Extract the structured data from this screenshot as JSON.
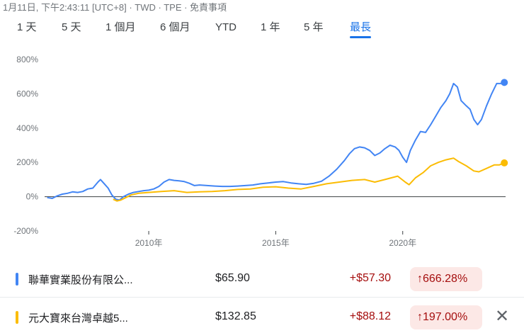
{
  "header": {
    "meta": "1月11日, 下午2:43:11 [UTC+8] · TWD · TPE · 免責事項"
  },
  "tabs": [
    {
      "label": "1 天",
      "active": false
    },
    {
      "label": "5 天",
      "active": false
    },
    {
      "label": "1 個月",
      "active": false
    },
    {
      "label": "6 個月",
      "active": false
    },
    {
      "label": "YTD",
      "active": false
    },
    {
      "label": "1 年",
      "active": false
    },
    {
      "label": "5 年",
      "active": false
    },
    {
      "label": "最長",
      "active": true
    }
  ],
  "chart_data": {
    "type": "line",
    "title": "",
    "xlabel": "",
    "ylabel": "",
    "x_range": [
      2005.9,
      2024.05
    ],
    "ylim": [
      -200,
      800
    ],
    "yticks": [
      800,
      600,
      400,
      200,
      0,
      -200
    ],
    "ytick_labels": [
      "800%",
      "600%",
      "400%",
      "200%",
      "0%",
      "-200%"
    ],
    "xticks": [
      2010,
      2015,
      2020
    ],
    "xtick_labels": [
      "2010年",
      "2015年",
      "2020年"
    ],
    "grid": false,
    "zero_line": true,
    "series": [
      {
        "name": "聯華實業股份有限公...",
        "color": "#4285f4",
        "points": [
          [
            2006.0,
            -5
          ],
          [
            2006.2,
            -10
          ],
          [
            2006.4,
            5
          ],
          [
            2006.6,
            15
          ],
          [
            2006.8,
            20
          ],
          [
            2007.0,
            28
          ],
          [
            2007.2,
            25
          ],
          [
            2007.4,
            30
          ],
          [
            2007.6,
            45
          ],
          [
            2007.8,
            50
          ],
          [
            2008.0,
            85
          ],
          [
            2008.1,
            100
          ],
          [
            2008.25,
            75
          ],
          [
            2008.4,
            50
          ],
          [
            2008.55,
            10
          ],
          [
            2008.7,
            -15
          ],
          [
            2008.85,
            -20
          ],
          [
            2009.0,
            0
          ],
          [
            2009.2,
            15
          ],
          [
            2009.4,
            25
          ],
          [
            2009.6,
            30
          ],
          [
            2009.8,
            35
          ],
          [
            2010.0,
            38
          ],
          [
            2010.2,
            45
          ],
          [
            2010.4,
            60
          ],
          [
            2010.6,
            85
          ],
          [
            2010.8,
            100
          ],
          [
            2011.0,
            95
          ],
          [
            2011.2,
            92
          ],
          [
            2011.4,
            88
          ],
          [
            2011.6,
            78
          ],
          [
            2011.8,
            65
          ],
          [
            2012.0,
            68
          ],
          [
            2012.3,
            65
          ],
          [
            2012.6,
            62
          ],
          [
            2012.9,
            60
          ],
          [
            2013.2,
            60
          ],
          [
            2013.5,
            62
          ],
          [
            2013.8,
            65
          ],
          [
            2014.1,
            68
          ],
          [
            2014.4,
            75
          ],
          [
            2014.7,
            80
          ],
          [
            2015.0,
            85
          ],
          [
            2015.3,
            88
          ],
          [
            2015.6,
            80
          ],
          [
            2015.9,
            75
          ],
          [
            2016.2,
            72
          ],
          [
            2016.5,
            78
          ],
          [
            2016.8,
            90
          ],
          [
            2017.1,
            120
          ],
          [
            2017.4,
            160
          ],
          [
            2017.7,
            210
          ],
          [
            2017.9,
            250
          ],
          [
            2018.1,
            280
          ],
          [
            2018.3,
            290
          ],
          [
            2018.5,
            285
          ],
          [
            2018.7,
            270
          ],
          [
            2018.9,
            240
          ],
          [
            2019.1,
            255
          ],
          [
            2019.3,
            280
          ],
          [
            2019.5,
            300
          ],
          [
            2019.7,
            290
          ],
          [
            2019.85,
            270
          ],
          [
            2020.0,
            230
          ],
          [
            2020.15,
            200
          ],
          [
            2020.3,
            270
          ],
          [
            2020.5,
            330
          ],
          [
            2020.7,
            380
          ],
          [
            2020.9,
            375
          ],
          [
            2021.1,
            420
          ],
          [
            2021.3,
            470
          ],
          [
            2021.5,
            520
          ],
          [
            2021.7,
            560
          ],
          [
            2021.85,
            600
          ],
          [
            2022.0,
            660
          ],
          [
            2022.15,
            640
          ],
          [
            2022.3,
            560
          ],
          [
            2022.5,
            530
          ],
          [
            2022.65,
            510
          ],
          [
            2022.8,
            450
          ],
          [
            2022.95,
            420
          ],
          [
            2023.1,
            450
          ],
          [
            2023.3,
            530
          ],
          [
            2023.5,
            600
          ],
          [
            2023.7,
            660
          ],
          [
            2023.85,
            660
          ],
          [
            2024.0,
            666.28
          ]
        ]
      },
      {
        "name": "元大寶來台灣卓越5...",
        "color": "#fbbc04",
        "points": [
          [
            2008.6,
            -15
          ],
          [
            2008.75,
            -25
          ],
          [
            2008.9,
            -20
          ],
          [
            2009.1,
            -5
          ],
          [
            2009.3,
            10
          ],
          [
            2009.6,
            20
          ],
          [
            2010.0,
            25
          ],
          [
            2010.5,
            30
          ],
          [
            2011.0,
            35
          ],
          [
            2011.5,
            25
          ],
          [
            2012.0,
            28
          ],
          [
            2012.5,
            30
          ],
          [
            2013.0,
            35
          ],
          [
            2013.5,
            42
          ],
          [
            2014.0,
            45
          ],
          [
            2014.5,
            55
          ],
          [
            2015.0,
            58
          ],
          [
            2015.5,
            50
          ],
          [
            2016.0,
            45
          ],
          [
            2016.5,
            60
          ],
          [
            2017.0,
            75
          ],
          [
            2017.5,
            85
          ],
          [
            2018.0,
            95
          ],
          [
            2018.5,
            100
          ],
          [
            2018.9,
            85
          ],
          [
            2019.3,
            100
          ],
          [
            2019.8,
            120
          ],
          [
            2020.1,
            85
          ],
          [
            2020.25,
            70
          ],
          [
            2020.5,
            110
          ],
          [
            2020.8,
            140
          ],
          [
            2021.1,
            180
          ],
          [
            2021.4,
            200
          ],
          [
            2021.7,
            215
          ],
          [
            2022.0,
            225
          ],
          [
            2022.2,
            205
          ],
          [
            2022.5,
            180
          ],
          [
            2022.8,
            150
          ],
          [
            2023.0,
            145
          ],
          [
            2023.3,
            165
          ],
          [
            2023.6,
            185
          ],
          [
            2023.8,
            185
          ],
          [
            2024.0,
            197.0
          ]
        ]
      }
    ]
  },
  "legend": [
    {
      "name": "聯華實業股份有限公...",
      "color": "#4285f4",
      "price": "$65.90",
      "change": "+$57.30",
      "percent": "666.28%"
    },
    {
      "name": "元大寶來台灣卓越5...",
      "color": "#fbbc04",
      "price": "$132.85",
      "change": "+$88.12",
      "percent": "197.00%"
    }
  ],
  "icons": {
    "up_arrow": "arrow-up-icon",
    "close": "close-icon"
  },
  "glyphs": {
    "up_arrow": "↑",
    "close": "✕"
  }
}
